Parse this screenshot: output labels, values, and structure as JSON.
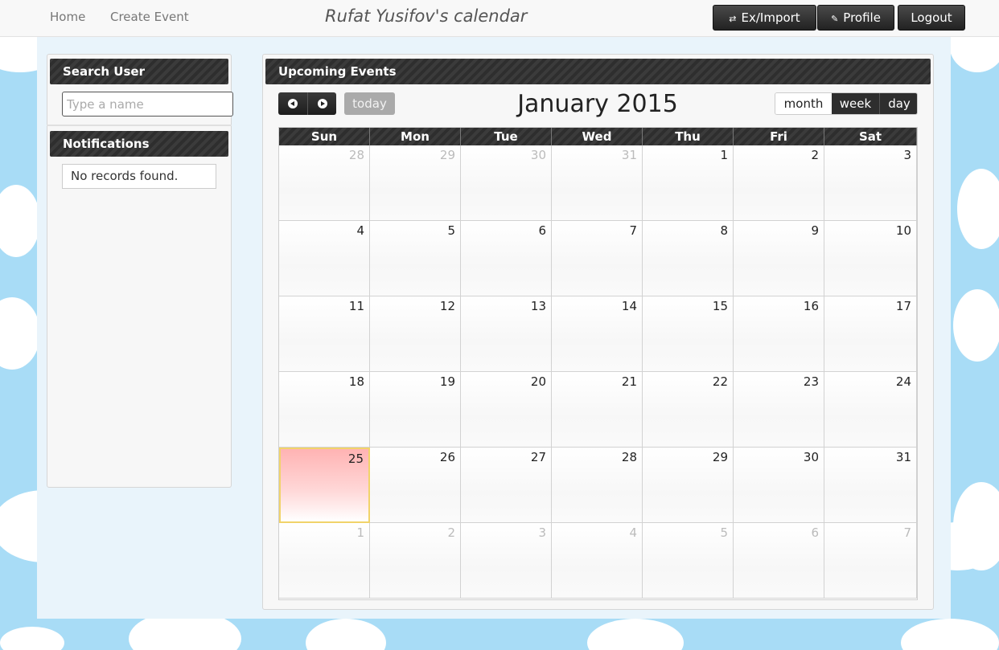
{
  "nav": {
    "home": "Home",
    "create_event": "Create Event",
    "brand": "Rufat Yusifov's calendar",
    "eximport": "Ex/Import",
    "profile": "Profile",
    "logout": "Logout"
  },
  "sidebar": {
    "search_title": "Search User",
    "search_placeholder": "Type a name",
    "notifications_title": "Notifications",
    "notifications_empty": "No records found."
  },
  "main": {
    "title": "Upcoming Events",
    "today_label": "today",
    "month_title": "January 2015",
    "views": [
      "month",
      "week",
      "day"
    ],
    "active_view": "month",
    "days_of_week": [
      "Sun",
      "Mon",
      "Tue",
      "Wed",
      "Thu",
      "Fri",
      "Sat"
    ],
    "weeks": [
      [
        28,
        29,
        30,
        31,
        1,
        2,
        3
      ],
      [
        4,
        5,
        6,
        7,
        8,
        9,
        10
      ],
      [
        11,
        12,
        13,
        14,
        15,
        16,
        17
      ],
      [
        18,
        19,
        20,
        21,
        22,
        23,
        24
      ],
      [
        25,
        26,
        27,
        28,
        29,
        30,
        31
      ],
      [
        1,
        2,
        3,
        4,
        5,
        6,
        7
      ]
    ],
    "today_date": 25
  },
  "colors": {
    "sky": "#a8dcf6",
    "dark_button": "#2a2a2a",
    "today_highlight": "#ffb3b3"
  }
}
